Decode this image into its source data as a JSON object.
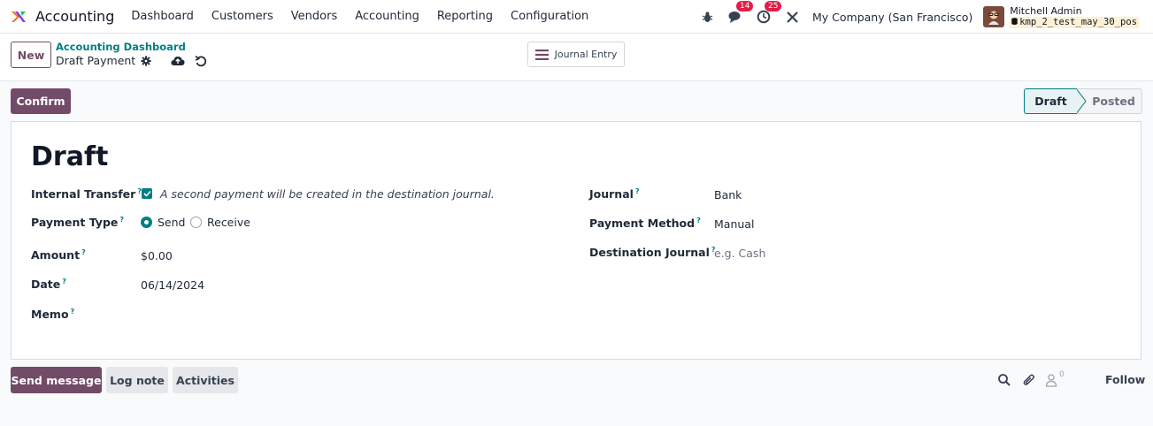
{
  "app": {
    "name": "Accounting",
    "menu": [
      "Dashboard",
      "Customers",
      "Vendors",
      "Accounting",
      "Reporting",
      "Configuration"
    ]
  },
  "systray": {
    "messages_count": "14",
    "activities_count": "25",
    "company": "My Company (San Francisco)",
    "user_name": "Mitchell Admin",
    "database": "kmp_2_test_may_30_pos"
  },
  "control_panel": {
    "new_label": "New",
    "breadcrumb_parent": "Accounting Dashboard",
    "breadcrumb_current": "Draft Payment",
    "journal_entry_label": "Journal Entry"
  },
  "actions": {
    "confirm_label": "Confirm"
  },
  "statusbar": {
    "stages": [
      "Draft",
      "Posted"
    ],
    "current": "Draft"
  },
  "form": {
    "title": "Draft",
    "internal_transfer_label": "Internal Transfer",
    "internal_transfer_checked": true,
    "internal_transfer_note": "A second payment will be created in the destination journal.",
    "payment_type_label": "Payment Type",
    "payment_type_options": [
      "Send",
      "Receive"
    ],
    "payment_type_selected": "Send",
    "amount_label": "Amount",
    "amount_value": "$0.00",
    "date_label": "Date",
    "date_value": "06/14/2024",
    "memo_label": "Memo",
    "journal_label": "Journal",
    "journal_value": "Bank",
    "payment_method_label": "Payment Method",
    "payment_method_value": "Manual",
    "destination_journal_label": "Destination Journal",
    "destination_journal_placeholder": "e.g. Cash",
    "help_mark": "?"
  },
  "chatter": {
    "send_message_label": "Send message",
    "log_note_label": "Log note",
    "activities_label": "Activities",
    "followers_count": "0",
    "follow_label": "Follow"
  },
  "colors": {
    "brand": "#714b67",
    "accent": "#017e84",
    "badge": "#e11d48"
  }
}
